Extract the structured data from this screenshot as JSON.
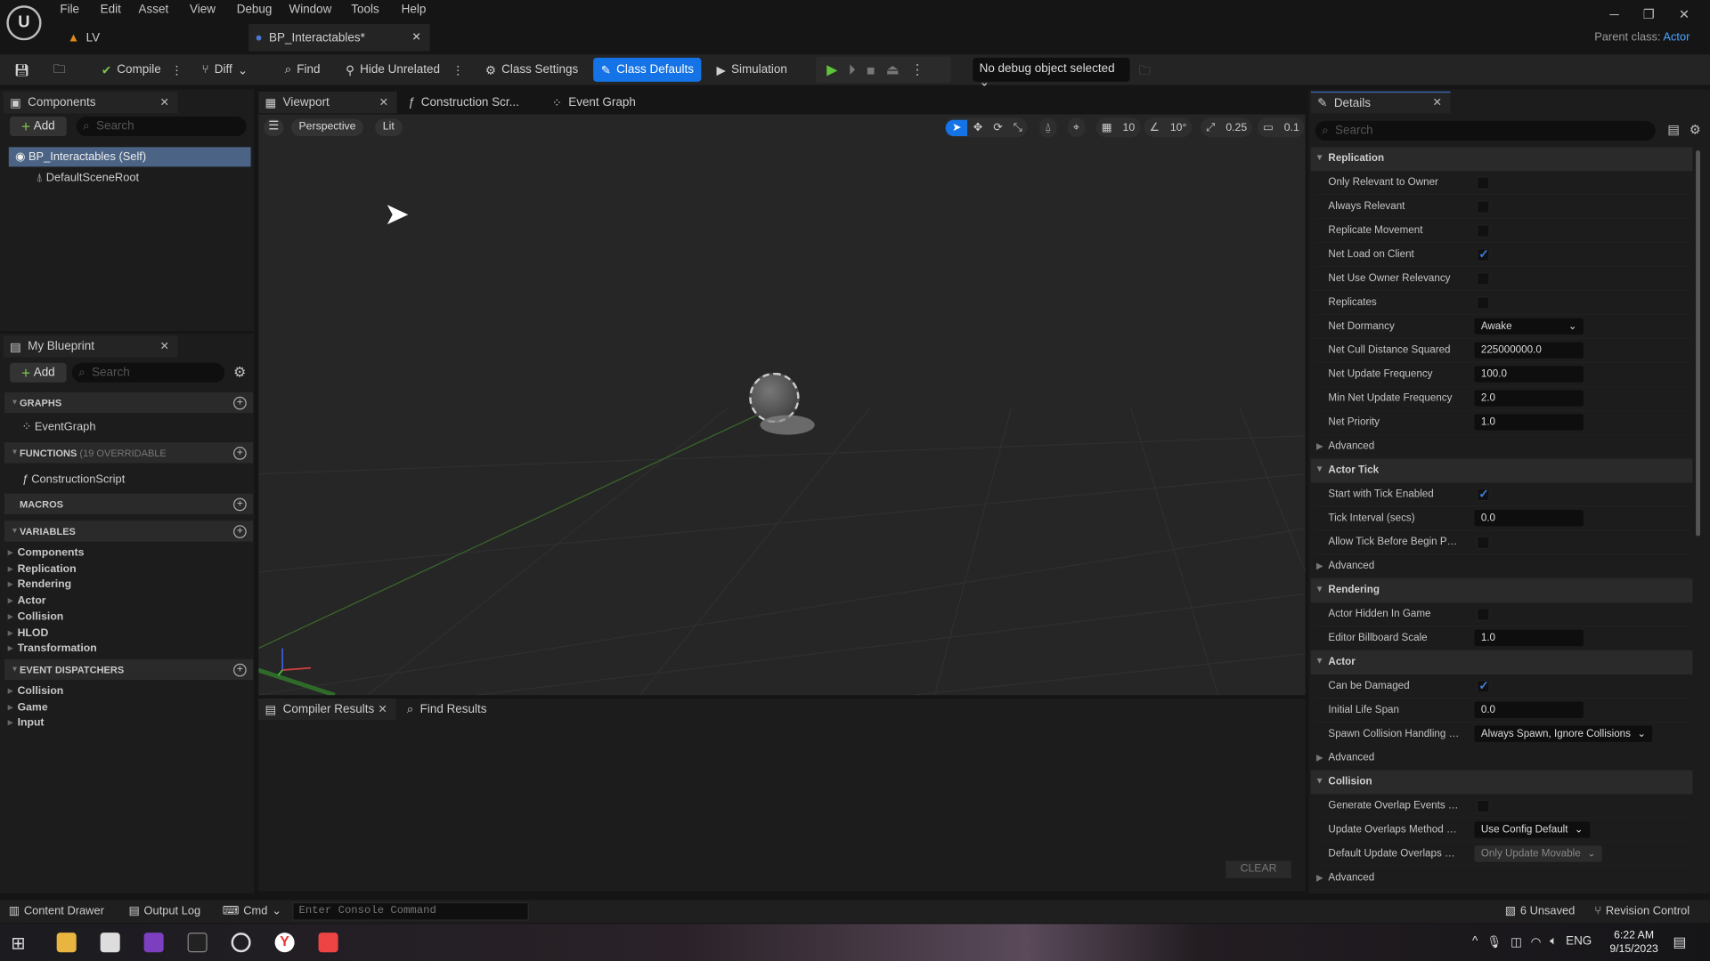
{
  "menu": [
    "File",
    "Edit",
    "Asset",
    "View",
    "Debug",
    "Window",
    "Tools",
    "Help"
  ],
  "tabs": [
    {
      "label": "LV"
    },
    {
      "label": "BP_Interactables*"
    }
  ],
  "parent_class": {
    "label": "Parent class:",
    "value": "Actor"
  },
  "toolbar": {
    "compile": "Compile",
    "diff": "Diff",
    "find": "Find",
    "hide_unrelated": "Hide Unrelated",
    "class_settings": "Class Settings",
    "class_defaults": "Class Defaults",
    "simulation": "Simulation",
    "debug_object": "No debug object selected"
  },
  "accent": "#1473e6",
  "components": {
    "title": "Components",
    "add": "Add",
    "search_placeholder": "Search",
    "items": [
      "BP_Interactables (Self)",
      "DefaultSceneRoot"
    ]
  },
  "my_blueprint": {
    "title": "My Blueprint",
    "add": "Add",
    "search_placeholder": "Search",
    "graphs": "GRAPHS",
    "graph_items": [
      "EventGraph"
    ],
    "functions": "FUNCTIONS",
    "functions_note": "(19 OVERRIDABLE",
    "function_items": [
      "ConstructionScript"
    ],
    "macros": "MACROS",
    "variables": "VARIABLES",
    "variable_items": [
      "Components",
      "Replication",
      "Rendering",
      "Actor",
      "Collision",
      "HLOD",
      "Transformation"
    ],
    "event_dispatchers": "EVENT DISPATCHERS",
    "dispatcher_items": [
      "Collision",
      "Game",
      "Input"
    ]
  },
  "editor_tabs": [
    "Viewport",
    "Construction Scr...",
    "Event Graph"
  ],
  "viewport": {
    "perspective": "Perspective",
    "lit": "Lit",
    "grid_snap": "10",
    "rotation_snap": "10°",
    "scale_snap": "0.25",
    "camera_speed": "0.1"
  },
  "bottom": {
    "tabs": [
      "Compiler Results",
      "Find Results"
    ],
    "clear": "CLEAR"
  },
  "details": {
    "title": "Details",
    "search_placeholder": "Search",
    "sections": [
      {
        "name": "Replication",
        "rows": [
          {
            "label": "Only Relevant to Owner",
            "type": "check",
            "value": false
          },
          {
            "label": "Always Relevant",
            "type": "check",
            "value": false
          },
          {
            "label": "Replicate Movement",
            "type": "check",
            "value": false
          },
          {
            "label": "Net Load on Client",
            "type": "check",
            "value": true
          },
          {
            "label": "Net Use Owner Relevancy",
            "type": "check",
            "value": false
          },
          {
            "label": "Replicates",
            "type": "check",
            "value": false
          },
          {
            "label": "Net Dormancy",
            "type": "select",
            "value": "Awake"
          },
          {
            "label": "Net Cull Distance Squared",
            "type": "text",
            "value": "225000000.0"
          },
          {
            "label": "Net Update Frequency",
            "type": "text",
            "value": "100.0"
          },
          {
            "label": "Min Net Update Frequency",
            "type": "text",
            "value": "2.0"
          },
          {
            "label": "Net Priority",
            "type": "text",
            "value": "1.0"
          },
          {
            "label": "Advanced",
            "type": "advanced"
          }
        ]
      },
      {
        "name": "Actor Tick",
        "rows": [
          {
            "label": "Start with Tick Enabled",
            "type": "check",
            "value": true
          },
          {
            "label": "Tick Interval (secs)",
            "type": "text",
            "value": "0.0"
          },
          {
            "label": "Allow Tick Before Begin Play",
            "type": "check",
            "value": false
          },
          {
            "label": "Advanced",
            "type": "advanced"
          }
        ]
      },
      {
        "name": "Rendering",
        "rows": [
          {
            "label": "Actor Hidden In Game",
            "type": "check",
            "value": false
          },
          {
            "label": "Editor Billboard Scale",
            "type": "text",
            "value": "1.0"
          }
        ]
      },
      {
        "name": "Actor",
        "rows": [
          {
            "label": "Can be Damaged",
            "type": "check",
            "value": true
          },
          {
            "label": "Initial Life Span",
            "type": "text",
            "value": "0.0"
          },
          {
            "label": "Spawn Collision Handling M...",
            "type": "select",
            "value": "Always Spawn, Ignore Collisions"
          },
          {
            "label": "Advanced",
            "type": "advanced"
          }
        ]
      },
      {
        "name": "Collision",
        "rows": [
          {
            "label": "Generate Overlap Events Du...",
            "type": "check",
            "value": false
          },
          {
            "label": "Update Overlaps Method Du...",
            "type": "select",
            "value": "Use Config Default"
          },
          {
            "label": "Default Update Overlaps Me...",
            "type": "select-disabled",
            "value": "Only Update Movable"
          },
          {
            "label": "Advanced",
            "type": "advanced"
          }
        ]
      }
    ]
  },
  "status": {
    "content_drawer": "Content Drawer",
    "output_log": "Output Log",
    "cmd": "Cmd",
    "console_placeholder": "Enter Console Command",
    "unsaved": "6 Unsaved",
    "revision_control": "Revision Control"
  },
  "taskbar": {
    "language": "ENG",
    "time": "6:22 AM",
    "date": "9/15/2023"
  }
}
